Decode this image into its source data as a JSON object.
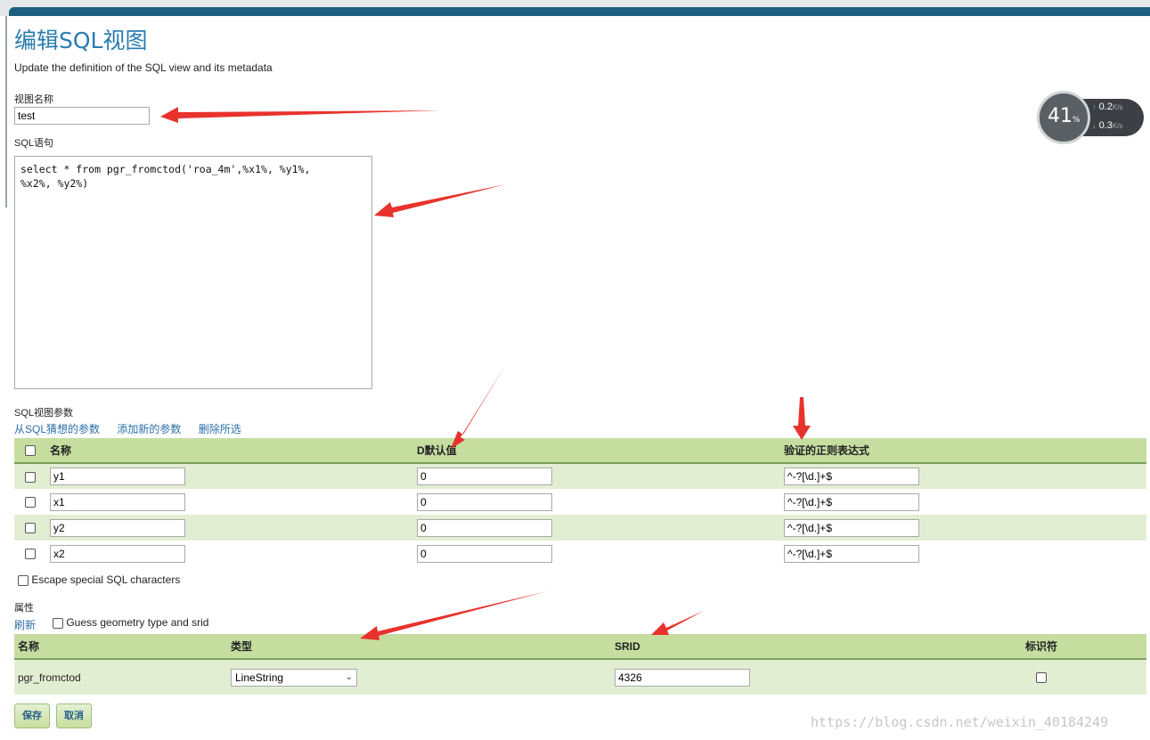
{
  "page": {
    "title": "编辑SQL视图",
    "description": "Update the definition of the SQL view and its metadata"
  },
  "view_name": {
    "label": "视图名称",
    "value": "test"
  },
  "sql": {
    "label": "SQL语句",
    "value": "select * from pgr_fromctod('roa_4m',%x1%, %y1%,\n%x2%, %y2%)"
  },
  "params": {
    "label": "SQL视图参数",
    "links": {
      "guess": "从SQL猜想的参数",
      "add": "添加新的参数",
      "remove": "删除所选"
    },
    "headers": {
      "name": "名称",
      "default": "D默认值",
      "regex": "验证的正则表达式"
    },
    "rows": [
      {
        "name": "y1",
        "default": "0",
        "regex": "^-?[\\d.]+$"
      },
      {
        "name": "x1",
        "default": "0",
        "regex": "^-?[\\d.]+$"
      },
      {
        "name": "y2",
        "default": "0",
        "regex": "^-?[\\d.]+$"
      },
      {
        "name": "x2",
        "default": "0",
        "regex": "^-?[\\d.]+$"
      }
    ]
  },
  "escape_label": "Escape special SQL characters",
  "attributes": {
    "label": "属性",
    "refresh": "刷新",
    "guess_label": "Guess geometry type and srid",
    "headers": {
      "name": "名称",
      "type": "类型",
      "srid": "SRID",
      "identifier": "标识符"
    },
    "row": {
      "name": "pgr_fromctod",
      "type": "LineString",
      "srid": "4326"
    }
  },
  "buttons": {
    "save": "保存",
    "cancel": "取消"
  },
  "widget": {
    "percent": "41",
    "percent_sign": "%",
    "up": "0.2",
    "down": "0.3",
    "unit": "K/s"
  },
  "watermark": "https://blog.csdn.net/weixin_40184249",
  "colors": {
    "title": "#2a7cb0",
    "header_bg": "#c5dea0",
    "row_alt": "#e2eed2",
    "arrow": "#e8322c",
    "link": "#2a6fa8"
  }
}
